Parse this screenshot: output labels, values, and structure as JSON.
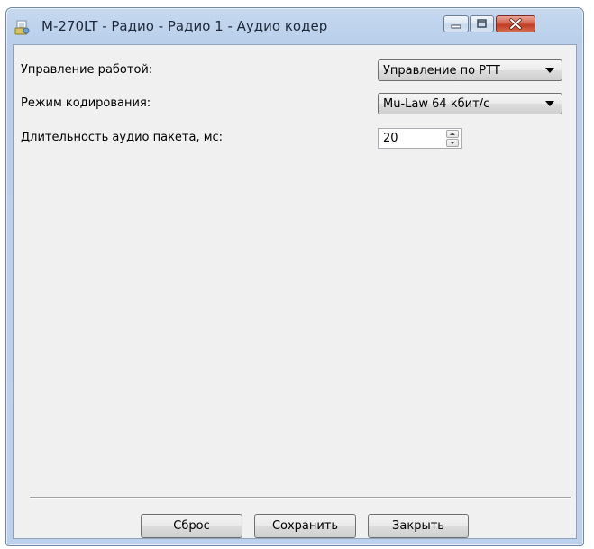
{
  "window": {
    "title": "M-270LT - Радио - Радио 1 - Аудио кодер",
    "icon": "app-document-icon",
    "controls": {
      "minimize_icon": "minimize-icon",
      "maximize_icon": "maximize-icon",
      "close_icon": "close-icon"
    }
  },
  "form": {
    "operation_control": {
      "label": "Управление работой:",
      "value": "Управление по PTT"
    },
    "encoding_mode": {
      "label": "Режим кодирования:",
      "value": "Mu-Law 64 кбит/с"
    },
    "packet_duration": {
      "label": "Длительность аудио пакета, мс:",
      "value": "20"
    }
  },
  "buttons": {
    "reset": "Сброс",
    "save": "Сохранить",
    "close": "Закрыть"
  },
  "colors": {
    "titlebar": "#c5d9ef",
    "content_bg": "#f0f0f0",
    "close_button": "#c03b22"
  }
}
